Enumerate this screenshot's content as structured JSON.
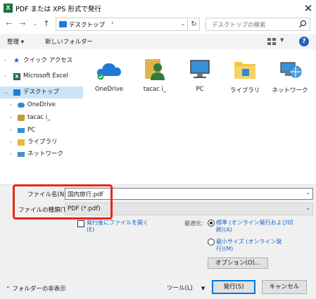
{
  "window": {
    "title": "PDF または XPS 形式で発行"
  },
  "address": {
    "location": "デスクトップ",
    "search_placeholder": "デスクトップの検索"
  },
  "toolbar": {
    "organize": "整理 ▾",
    "new_folder": "新しいフォルダー"
  },
  "nav": {
    "items": [
      {
        "label": "クイック アクセス"
      },
      {
        "label": "Microsoft Excel"
      },
      {
        "label": "デスクトップ"
      },
      {
        "label": "OneDrive"
      },
      {
        "label": "tacac i_"
      },
      {
        "label": "PC"
      },
      {
        "label": "ライブラリ"
      },
      {
        "label": "ネットワーク"
      }
    ]
  },
  "files": [
    {
      "label": "OneDrive"
    },
    {
      "label": "tacac i_"
    },
    {
      "label": "PC"
    },
    {
      "label": "ライブラリ"
    },
    {
      "label": "ネットワーク"
    }
  ],
  "form": {
    "filename_label": "ファイル名(N):",
    "filename_value": "国内旅行.pdf",
    "filetype_label": "ファイルの種類(T):",
    "filetype_value": "PDF (*.pdf)",
    "open_after": "発行後にファイルを開く(E)",
    "optimize_label": "最適化:",
    "opt_standard": "標準 (オンライン発行および印刷)(A)",
    "opt_minimum": "最小サイズ (オンライン発行)(M)",
    "options_button": "オプション(O)..."
  },
  "footer": {
    "hide_folders": "フォルダーの非表示",
    "tools": "ツール(L)",
    "publish": "発行(S)",
    "cancel": "キャンセル"
  },
  "colors": {
    "accent": "#0078d7",
    "highlight": "#e8281a",
    "selected": "#cce4f7"
  }
}
